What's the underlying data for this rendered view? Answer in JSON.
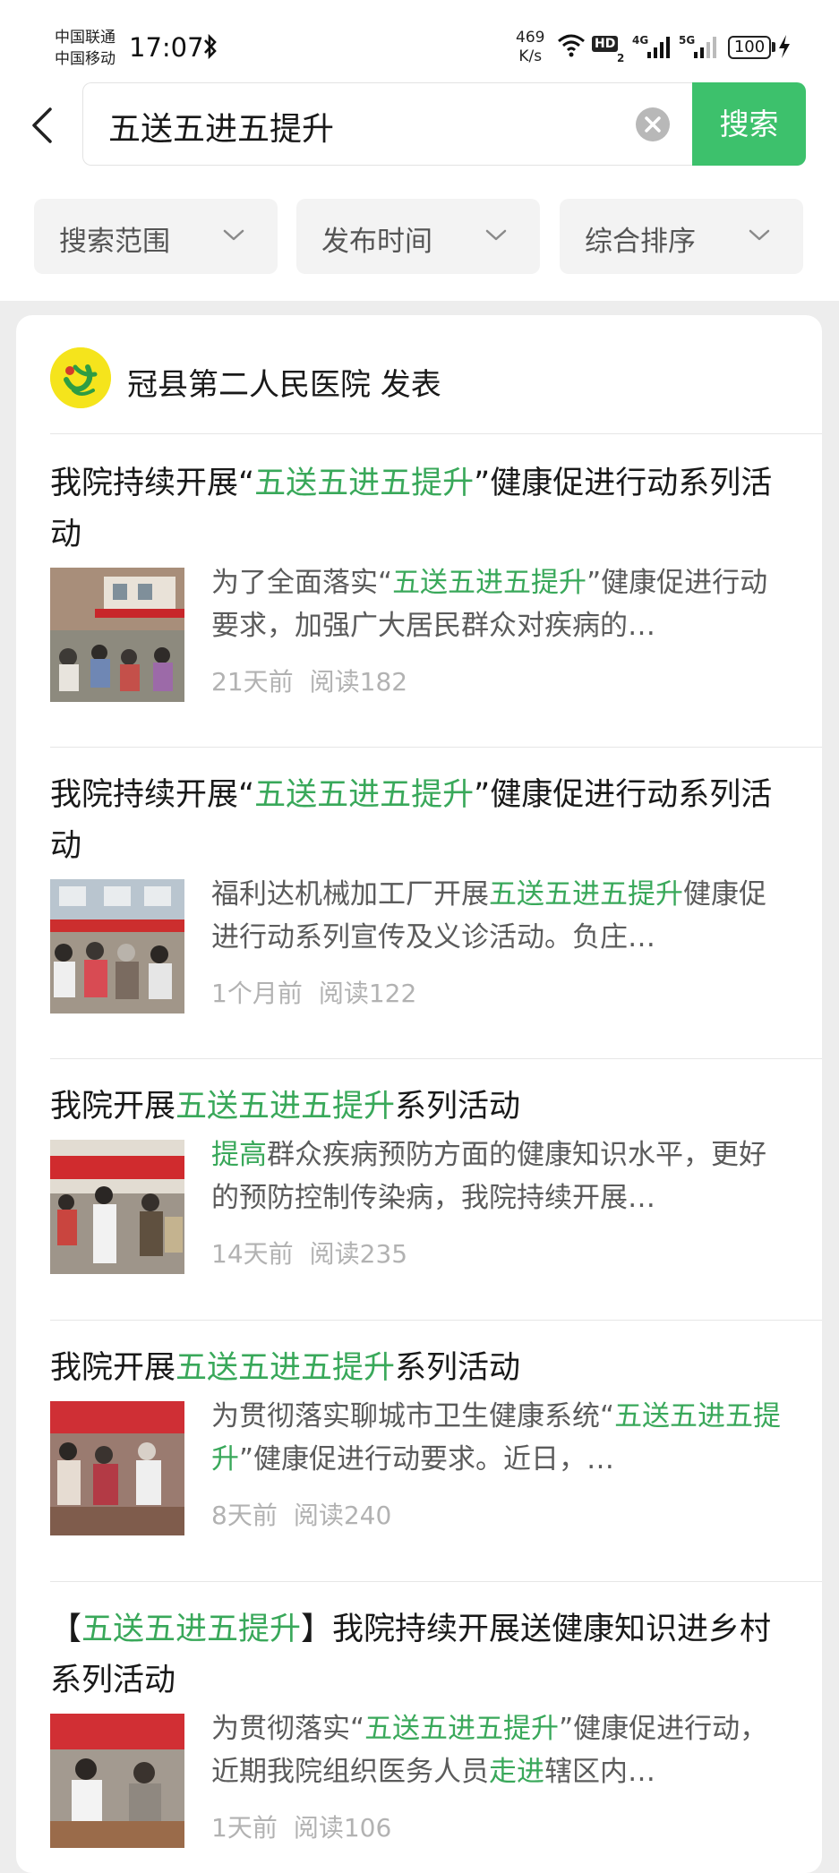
{
  "status_bar": {
    "carrier_1": "中国联通",
    "carrier_2": "中国移动",
    "time": "17:07",
    "net_speed_value": "469",
    "net_speed_unit": "K/s",
    "hd_label": "HD",
    "hd_sub": "2",
    "sig1_label": "4G",
    "sig2_label": "5G",
    "battery": "100"
  },
  "search": {
    "query": "五送五进五提升",
    "button_label": "搜索"
  },
  "filters": [
    {
      "label": "搜索范围"
    },
    {
      "label": "发布时间"
    },
    {
      "label": "综合排序"
    }
  ],
  "publisher": {
    "name": "冠县第二人民医院 发表"
  },
  "results": [
    {
      "title": [
        {
          "t": "我院持续开展“"
        },
        {
          "t": "五送五进五提升",
          "hl": true
        },
        {
          "t": "”健康促进行动系列活动"
        }
      ],
      "desc": [
        {
          "t": "为了全面落实“"
        },
        {
          "t": "五送五进五提升",
          "hl": true
        },
        {
          "t": "”健康促进行动要求，加强广大居民群众对疾病的…"
        }
      ],
      "time": "21天前",
      "reads": "阅读182"
    },
    {
      "title": [
        {
          "t": "我院持续开展“"
        },
        {
          "t": "五送五进五提升",
          "hl": true
        },
        {
          "t": "”健康促进行动系列活动"
        }
      ],
      "desc": [
        {
          "t": "福利达机械加工厂开展"
        },
        {
          "t": "五送五进五提升",
          "hl": true
        },
        {
          "t": "健康促进行动系列宣传及义诊活动。负庄…"
        }
      ],
      "time": "1个月前",
      "reads": "阅读122"
    },
    {
      "title": [
        {
          "t": "我院开展"
        },
        {
          "t": "五送五进五提升",
          "hl": true
        },
        {
          "t": "系列活动"
        }
      ],
      "desc": [
        {
          "t": "提高",
          "hl": true
        },
        {
          "t": "群众疾病预防方面的健康知识水平，更好的预防控制传染病，我院持续开展…"
        }
      ],
      "time": "14天前",
      "reads": "阅读235"
    },
    {
      "title": [
        {
          "t": "我院开展"
        },
        {
          "t": "五送五进五提升",
          "hl": true
        },
        {
          "t": "系列活动"
        }
      ],
      "desc": [
        {
          "t": "为贯彻落实聊城市卫生健康系统“"
        },
        {
          "t": "五送五进五提升",
          "hl": true
        },
        {
          "t": "”健康促进行动要求。近日，…"
        }
      ],
      "time": "8天前",
      "reads": "阅读240"
    },
    {
      "title": [
        {
          "t": "【"
        },
        {
          "t": "五送五进五提升",
          "hl": true
        },
        {
          "t": "】我院持续开展送健康知识进乡村系列活动"
        }
      ],
      "desc": [
        {
          "t": "为贯彻落实“"
        },
        {
          "t": "五送五进五提升",
          "hl": true
        },
        {
          "t": "”健康促进行动，近期我院组织医务人员"
        },
        {
          "t": "走进",
          "hl": true
        },
        {
          "t": "辖区内…"
        }
      ],
      "time": "1天前",
      "reads": "阅读106"
    }
  ],
  "colors": {
    "accent": "#3dc16c",
    "highlight": "#39a85a"
  }
}
